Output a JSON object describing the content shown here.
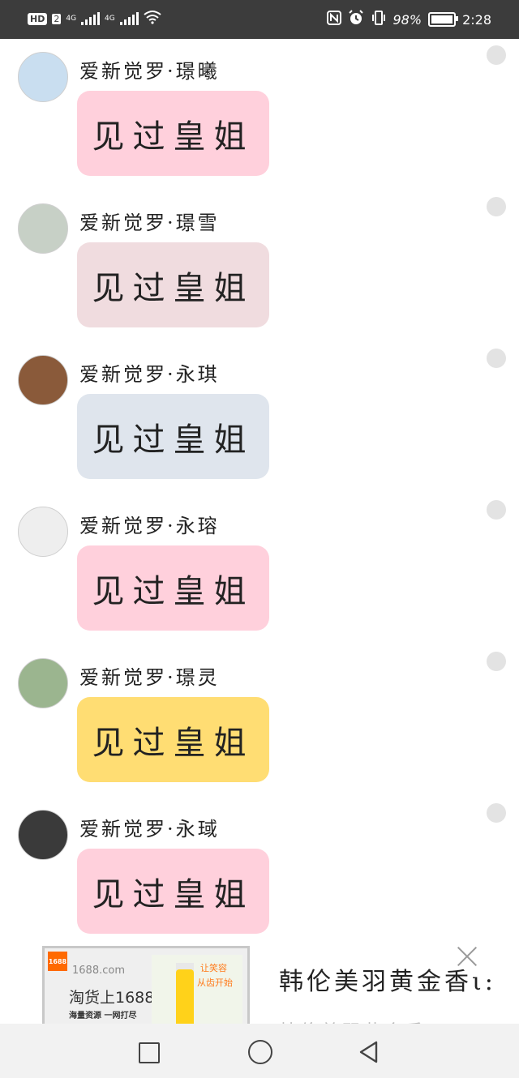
{
  "status_bar": {
    "hd": "HD",
    "sim": "2",
    "net1": "4G",
    "net2": "4G",
    "battery_percent": "98%",
    "battery_level": 0.98,
    "time": "2:28"
  },
  "messages": [
    {
      "name": "爱新觉罗·璟曦",
      "text": "见过皇姐",
      "bubble_color": "#ffd0dc",
      "avatar_color": "#c9def0"
    },
    {
      "name": "爱新觉罗·璟雪",
      "text": "见过皇姐",
      "bubble_color": "#f0dcdf",
      "avatar_color": "#c7d0c6"
    },
    {
      "name": "爱新觉罗·永琪",
      "text": "见过皇姐",
      "bubble_color": "#dfe5ed",
      "avatar_color": "#8a5a3a"
    },
    {
      "name": "爱新觉罗·永瑢",
      "text": "见过皇姐",
      "bubble_color": "#ffd0dc",
      "avatar_color": "#eeeeee"
    },
    {
      "name": "爱新觉罗·璟灵",
      "text": "见过皇姐",
      "bubble_color": "#ffdd73",
      "avatar_color": "#9bb58f"
    },
    {
      "name": "爱新觉罗·永琙",
      "text": "见过皇姐",
      "bubble_color": "#ffd0dc",
      "avatar_color": "#3a3a3a"
    }
  ],
  "ad": {
    "logo": "1688",
    "domain": "1688.com",
    "slogan": "淘货上1688",
    "sub": "海量资源 一网打尽",
    "product_line1": "让笑容",
    "product_line2": "从齿开始"
  },
  "headline": "韩伦美羽黄金香ι:",
  "faded_text": "韩伦美羽黄金香ι:"
}
